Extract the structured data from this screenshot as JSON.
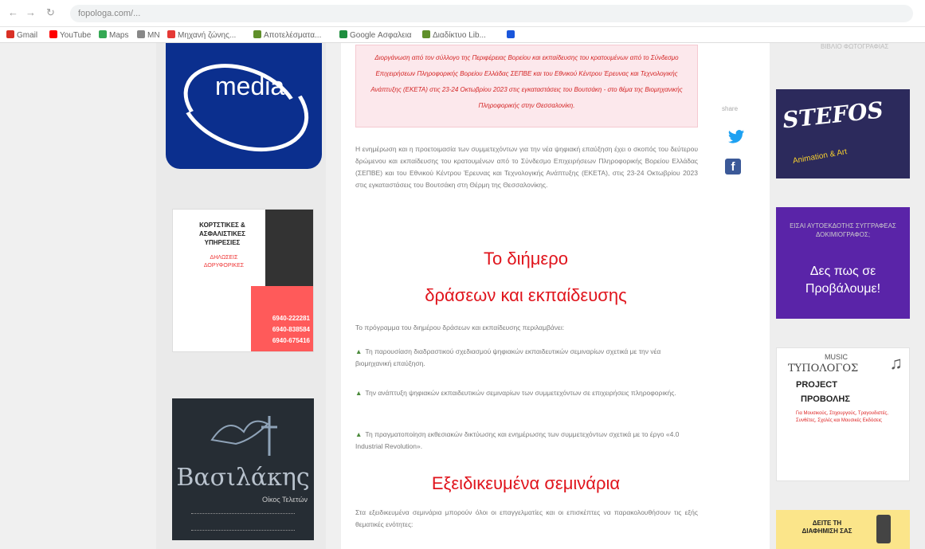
{
  "browser": {
    "url": "fopologa.com/...",
    "bookmarks": [
      "Gmail",
      "YouTube",
      "Maps",
      "MN",
      "Μηχανή ζώνης...",
      "Αποτελέσματα...",
      "Google Ασφαλεια",
      "Διαδίκτυο Lib..."
    ]
  },
  "left_ads": {
    "media_logo": "media",
    "ad1": {
      "title": "ΚΟΡΤΣΤΙΚΕΣ & ΑΣΦΑΛΙΣΤΙΚΕΣ ΥΠΗΡΕΣΙΕΣ",
      "sub": "ΔΗΛΩΣΕΙΣ ΔΟΡΥΦΟΡΙΚΕΣ",
      "phones": [
        "6940-222281",
        "6940-838584",
        "6940-675416"
      ]
    },
    "ad2": {
      "name": "Βασιλάκης",
      "sub": "Οίκος Τελετών"
    }
  },
  "article": {
    "notice": "Διοργάνωση από τον σύλλογο της Περιφέρειας Βορείου και εκπαίδευσης του κρατουμένων από το Σύνδεσμο Επιχειρήσεων Πληροφορικής Βορείου Ελλάδας ΣΕΠΒΕ και του Εθνικού Κέντρου Έρευνας και Τεχνολογικής Ανάπτυξης (ΕΚΕΤΑ) στις 23-24 Οκτωβρίου 2023 στις εγκαταστάσεις του Βουτσάκη - στο θέμα της Βιομηχανικής Πληροφορικής στην Θεσσαλονίκη.",
    "intro": "Η ενημέρωση και η προετοιμασία των συμμετεχόντων για την νέα ψηφιακή επαύξηση έχει ο σκοπός του δεύτερου δρώμενου και εκπαίδευσης του κρατουμένων από το Σύνδεσμο Επιχειρήσεων Πληροφορικής Βορείου Ελλάδας (ΣΕΠΒΕ) και του Εθνικού Κέντρου Έρευνας και Τεχνολογικής Ανάπτυξης (ΕΚΕΤΑ), στις 23-24 Οκτωβρίου 2023 στις εγκαταστάσεις του Βουτσάκη στη Θέρμη της Θεσσαλονίκης.",
    "heading1_line1": "Το διήμερο",
    "heading1_line2": "δράσεων και εκπαίδευσης",
    "program": "Το πρόγραμμα του διημέρου δράσεων και εκπαίδευσης περιλαμβάνει:",
    "bullets": [
      "Τη παρουσίαση διαδραστικού σχεδιασμού ψηφιακών εκπαιδευτικών σεμιναρίων σχετικά με την νέα βιομηχανική επαύξηση.",
      "Την ανάπτυξη ψηφιακών εκπαιδευτικών σεμιναρίων των συμμετεχόντων σε επιχειρήσεις πληροφορικής.",
      "Τη πραγματοποίηση εκθεσιακών δικτύωσης και ενημέρωσης των συμμετεχόντων σχετικά με το έργο «4.0 Industrial Revolution»."
    ],
    "heading2": "Εξειδικευμένα σεμινάρια",
    "seminars": "Στα εξειδικευμένα σεμινάρια μπορούν όλοι οι επαγγελματίες και οι επισκέπτες να παρακολουθήσουν τις εξής θεματικές ενότητες:"
  },
  "share": {
    "label": "share"
  },
  "right_ads": {
    "top_text": "ΒΙΒΛΙΟ ΦΩΤΟΓΡΑΦΙΑΣ",
    "stefos": "STEFOS",
    "stefos_sub": "Animation & Art",
    "promo_small": "ΕΙΣΑΙ ΑΥΤΟΕΚΔΟΤΗΣ ΣΥΓΓΡΑΦΕΑΣ ΔΟΚΙΜΙΟΓΡΑΦΟΣ;",
    "promo_big": "Δες πως σε Προβάλουμε!",
    "music": {
      "m1": "MUSIC",
      "m2": "ΤΥΠΟΛΟΓΟΣ",
      "m3": "PROJECT",
      "m4": "ΠΡΟΒΟΛΗΣ",
      "m5": "Για Μουσικούς, Στιχουργούς, Τραγουδιστές, Συνθέτες, Σχολές και Μουσικές Εκδόσεις"
    },
    "yellow": "ΔΕΙΤΕ ΤΗ ΔΙΑΦΗΜΙΣΗ ΣΑΣ"
  },
  "colors": {
    "heading": "#e0141c",
    "link": "#1d9bb8",
    "twitter": "#1da1f2",
    "facebook": "#3b5998"
  }
}
